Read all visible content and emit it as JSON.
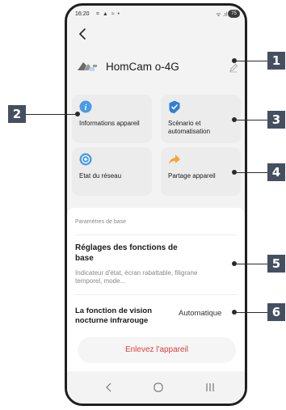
{
  "status_bar": {
    "time": "16:20",
    "notification_icons": "⌗ ▲ ≈ •",
    "signal_icons": "ᯤ .ıl",
    "battery": "75"
  },
  "header": {
    "back_icon": "chevron-left-icon"
  },
  "device": {
    "name": "HomCam o-4G",
    "edit_icon": "pencil-icon"
  },
  "quick_actions": [
    {
      "label": "Informations appareil",
      "icon": "info-icon",
      "color": "#4a9be8"
    },
    {
      "label": "Scènario et automatisation",
      "icon": "check-shield-icon",
      "color": "#2f7fd6"
    },
    {
      "label": "Etat du réseau",
      "icon": "network-icon",
      "color": "#4a9be8"
    },
    {
      "label": "Partage appareil",
      "icon": "share-arrow-icon",
      "color": "#f4a43c"
    }
  ],
  "settings": {
    "section_header": "Paramètres de base",
    "base_settings": {
      "title": "Réglages des fonctions de base",
      "description": "Indicateur d'état, écran rabattable, filigrane temporel, mode..."
    },
    "night_vision": {
      "title": "La fonction de vision nocturne infrarouge",
      "value": "Automatique"
    },
    "remove_button": "Enlevez l'appareil"
  },
  "nav_bar": {
    "back": "‹",
    "home": "◯",
    "recent": "⦀"
  },
  "callouts": [
    "1",
    "2",
    "3",
    "4",
    "5",
    "6"
  ],
  "colors": {
    "callout_bg": "#44505f",
    "remove_text": "#e0413f",
    "card_bg": "#ececec",
    "screen_bg": "#f3f3f3"
  }
}
